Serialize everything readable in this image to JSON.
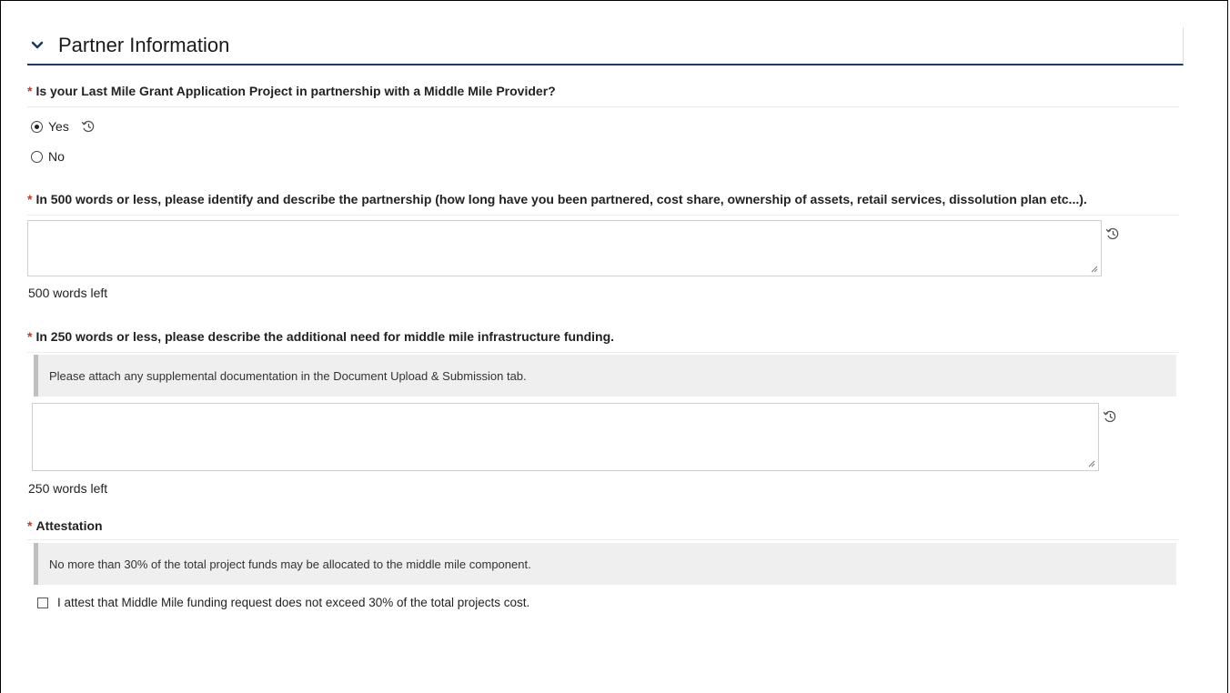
{
  "section": {
    "title": "Partner Information",
    "icon": "chevron-down-icon",
    "accent": "#1f3a5f"
  },
  "required_marker": "*",
  "q1": {
    "label": "Is your Last Mile Grant Application Project in partnership with a Middle Mile Provider?",
    "options": [
      "Yes",
      "No"
    ],
    "selected": "Yes"
  },
  "q2": {
    "label": "In 500 words or less, please identify and describe the partnership (how long have you been partnered, cost share, ownership of assets, retail services, dissolution plan etc...).",
    "value": "",
    "counter": "500 words left"
  },
  "q3": {
    "label": "In 250 words or less, please describe the additional need for middle mile infrastructure funding.",
    "note": "Please attach any supplemental documentation in the Document Upload & Submission tab.",
    "value": "",
    "counter": "250 words left"
  },
  "q4": {
    "label": "Attestation",
    "note": "No more than 30% of the total project funds may be allocated to the middle mile component.",
    "checkbox_label": "I attest that Middle Mile funding request does not exceed 30% of the total projects cost.",
    "checked": false
  },
  "colors": {
    "required": "#c0392b",
    "rule": "#1f3a5f",
    "notice_bg": "#efefef",
    "notice_bar": "#bfbfbf"
  }
}
